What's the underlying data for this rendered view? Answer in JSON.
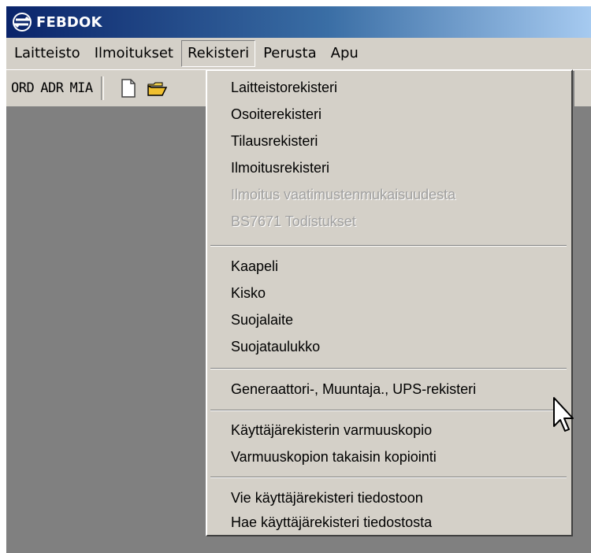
{
  "window": {
    "title": "FEBDOK"
  },
  "menubar": {
    "items": [
      {
        "label": "Laitteisto"
      },
      {
        "label": "Ilmoitukset"
      },
      {
        "label": "Rekisteri"
      },
      {
        "label": "Perusta"
      },
      {
        "label": "Apu"
      }
    ]
  },
  "toolbar": {
    "ord_label": "ORD",
    "adr_label": "ADR",
    "mia_label": "MIA",
    "icons": [
      "new-document-icon",
      "open-folder-icon"
    ]
  },
  "dropdown": {
    "groups": [
      [
        {
          "label": "Laitteistorekisteri",
          "enabled": true
        },
        {
          "label": "Osoiterekisteri",
          "enabled": true
        },
        {
          "label": "Tilausrekisteri",
          "enabled": true
        },
        {
          "label": "Ilmoitusrekisteri",
          "enabled": true
        },
        {
          "label": "Ilmoitus vaatimustenmukaisuudesta",
          "enabled": false
        },
        {
          "label": "BS7671 Todistukset",
          "enabled": false
        }
      ],
      [
        {
          "label": "Kaapeli",
          "enabled": true
        },
        {
          "label": "Kisko",
          "enabled": true
        },
        {
          "label": "Suojalaite",
          "enabled": true
        },
        {
          "label": "Suojataulukko",
          "enabled": true
        }
      ],
      [
        {
          "label": "Generaattori-, Muuntaja., UPS-rekisteri",
          "enabled": true
        }
      ],
      [
        {
          "label": "Käyttäjärekisterin varmuuskopio",
          "enabled": true
        },
        {
          "label": "Varmuuskopion takaisin kopiointi",
          "enabled": true
        }
      ],
      [
        {
          "label": "Vie käyttäjärekisteri tiedostoon",
          "enabled": true
        },
        {
          "label": "Hae käyttäjärekisteri tiedostosta",
          "enabled": true
        }
      ]
    ]
  },
  "colors": {
    "menu_bg": "#d4d0c8",
    "workspace": "#808080",
    "title_start": "#0a246a",
    "title_end": "#a6caf0",
    "disabled_text": "#a0a0a0"
  }
}
